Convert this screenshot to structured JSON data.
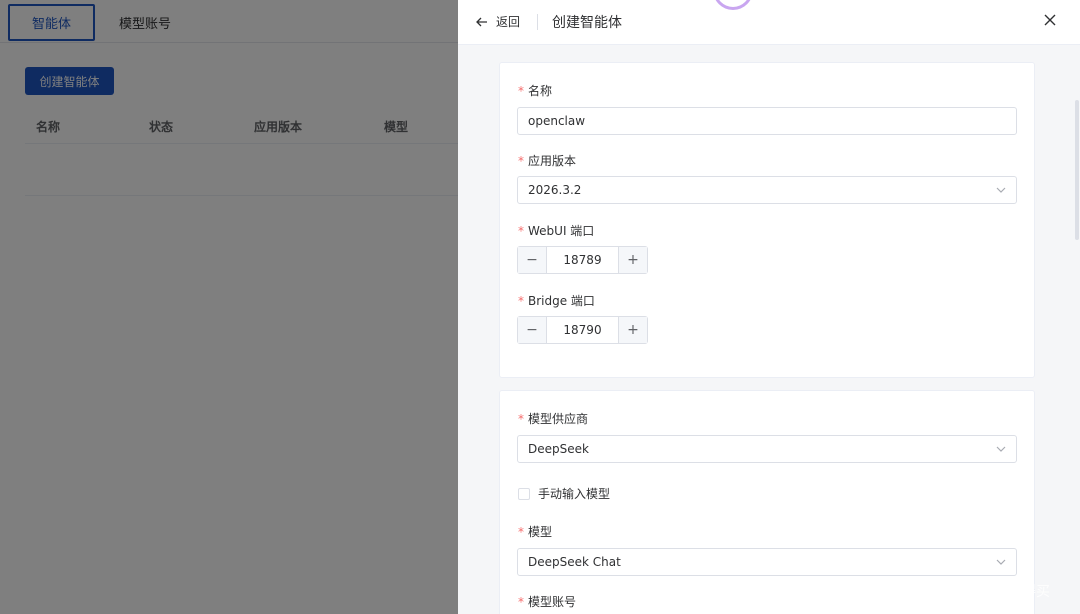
{
  "background": {
    "tabs": [
      {
        "label": "智能体",
        "active": true
      },
      {
        "label": "模型账号",
        "active": false
      }
    ],
    "create_button": "创建智能体",
    "table_headers": [
      "名称",
      "状态",
      "应用版本",
      "模型"
    ]
  },
  "drawer": {
    "back_label": "返回",
    "title": "创建智能体",
    "section1": {
      "name_label": "名称",
      "name_value": "openclaw",
      "version_label": "应用版本",
      "version_value": "2026.3.2",
      "webui_port_label": "WebUI 端口",
      "webui_port_value": "18789",
      "bridge_port_label": "Bridge 端口",
      "bridge_port_value": "18790"
    },
    "section2": {
      "provider_label": "模型供应商",
      "provider_value": "DeepSeek",
      "manual_model_label": "手动输入模型",
      "model_label": "模型",
      "model_value": "DeepSeek Chat",
      "account_label": "模型账号"
    }
  },
  "watermark": {
    "logo": "值",
    "text": "什么值得买"
  },
  "colors": {
    "primary": "#1f57c3",
    "required": "#f56c6c",
    "overlay": "rgba(0,0,0,0.5)"
  }
}
